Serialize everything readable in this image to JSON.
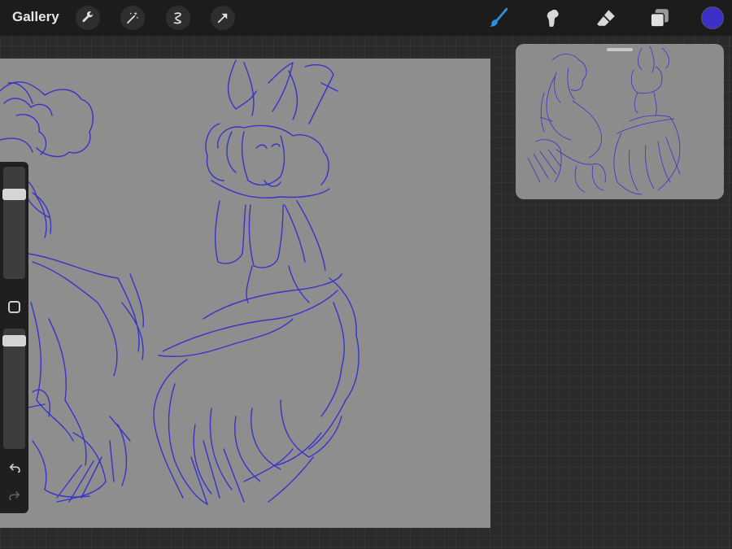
{
  "toolbar": {
    "gallery_label": "Gallery",
    "left_tools": [
      "wrench-icon",
      "magic-wand-icon",
      "selection-icon",
      "transform-arrow-icon"
    ],
    "right_tools": [
      "brush-icon",
      "smudge-icon",
      "eraser-icon",
      "layers-icon"
    ],
    "active_tool": "brush-icon",
    "current_color": "#3a30c8"
  },
  "colors": {
    "stroke": "#3b32c9",
    "canvas_bg": "#8e8e8e",
    "background": "#2b2b2b",
    "toolbar_bg": "#1c1c1c",
    "active_tool_accent": "#2b8fe0"
  },
  "sidebar": {
    "brush_size": 0.78,
    "brush_opacity": 0.94,
    "icons": [
      "modify-square-icon",
      "undo-icon",
      "redo-icon"
    ]
  }
}
